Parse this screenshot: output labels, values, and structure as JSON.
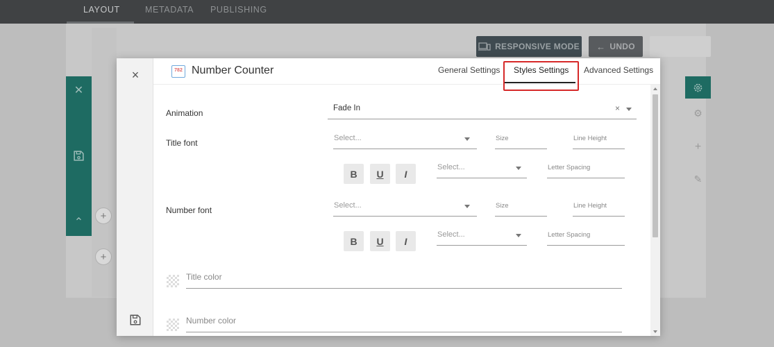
{
  "topnav": {
    "tabs": [
      {
        "label": "LAYOUT",
        "active": true
      },
      {
        "label": "METADATA",
        "active": false
      },
      {
        "label": "PUBLISHING",
        "active": false
      }
    ]
  },
  "toolbar": {
    "responsive_label": "RESPONSIVE MODE",
    "undo_label": "UNDO"
  },
  "modal": {
    "title": "Number Counter",
    "icon_text": "782",
    "tabs": {
      "general": "General Settings",
      "styles": "Styles Settings",
      "advanced": "Advanced Settings",
      "active": "styles"
    },
    "fields": {
      "animation": {
        "label": "Animation",
        "value": "Fade In"
      },
      "title_font": {
        "label": "Title font",
        "family_placeholder": "Select...",
        "size_placeholder": "Size",
        "line_height_placeholder": "Line Height",
        "weight_placeholder": "Select...",
        "letter_spacing_placeholder": "Letter Spacing"
      },
      "number_font": {
        "label": "Number font",
        "family_placeholder": "Select...",
        "size_placeholder": "Size",
        "line_height_placeholder": "Line Height",
        "weight_placeholder": "Select...",
        "letter_spacing_placeholder": "Letter Spacing"
      },
      "format_buttons": {
        "bold": "B",
        "underline": "U",
        "italic": "I"
      },
      "title_color": {
        "placeholder": "Title color"
      },
      "number_color": {
        "placeholder": "Number color"
      }
    }
  },
  "colors": {
    "rail_teal": "#1e6b62",
    "highlight_red": "#d62828",
    "topnav_bg": "#404244"
  }
}
